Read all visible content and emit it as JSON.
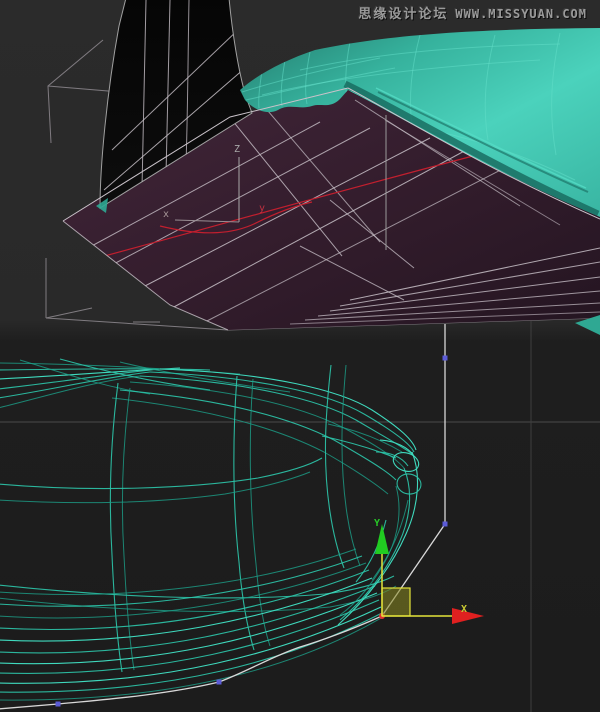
{
  "watermark": {
    "forum_name": "思缘设计论坛",
    "site_url": "WWW.MISSYUAN.COM"
  },
  "viewport_top": {
    "type": "perspective-shaded-view",
    "axis_tripod": {
      "x_label": "x",
      "y_label": "y",
      "z_label": "Z"
    }
  },
  "viewport_bottom": {
    "type": "orthographic-wireframe-view",
    "gizmo": {
      "x_label": "X",
      "y_label": "Y"
    },
    "spline_vertex_count_visible": 4
  },
  "colors": {
    "bg_top": "#2a2a2a",
    "bg_bottom": "#1c1c1c",
    "teal_bright": "#4fd7c0",
    "teal_mid": "#3fc9b4",
    "teal_dark": "#1e7b6d",
    "teal_edge_shadow": "#14584e",
    "teal_wire": "#2cc3a8",
    "teal_wire_light": "#63dfca",
    "purple_surface": "#38202f",
    "purple_dark": "#241521",
    "black_mesh": "#060606",
    "wire_gray": "#c9c2c9",
    "red_line": "#c21f2e",
    "spline_white": "#d8d8d8",
    "vertex_blue": "#5b5bd6",
    "vertex_selected_red": "#e03030",
    "gizmo_yellow": "#e3e33a",
    "gizmo_green": "#22cc22",
    "gizmo_red": "#dd2020",
    "grid_line": "#4a4a4a",
    "watermark": "#9a9a9a"
  }
}
